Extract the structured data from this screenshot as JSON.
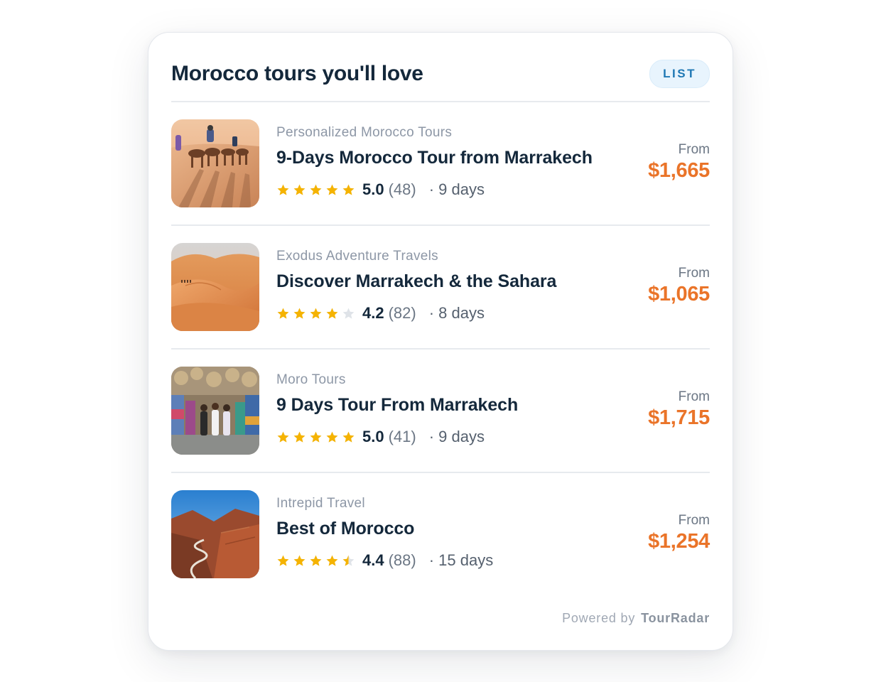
{
  "widget": {
    "title": "Morocco tours you'll love",
    "view_badge": "LIST",
    "footer": {
      "powered_by": "Powered by",
      "brand": "TourRadar"
    }
  },
  "colors": {
    "title": "#14283b",
    "price": "#ea7429",
    "star_filled": "#f5b301",
    "star_empty": "#dfe3e8",
    "badge_bg": "#e8f4fd",
    "badge_text": "#1f78b4"
  },
  "tours": [
    {
      "operator": "Personalized Morocco Tours",
      "name": "9-Days Morocco Tour from Marrakech",
      "rating": "5.0",
      "rating_value": 5.0,
      "reviews": "(48)",
      "duration": "· 9 days",
      "from_label": "From",
      "price": "$1,665",
      "image": "camel-caravan-desert-photo"
    },
    {
      "operator": "Exodus Adventure Travels",
      "name": "Discover Marrakech & the Sahara",
      "rating": "4.2",
      "rating_value": 4.0,
      "reviews": "(82)",
      "duration": "· 8 days",
      "from_label": "From",
      "price": "$1,065",
      "image": "sahara-sand-dunes-photo"
    },
    {
      "operator": "Moro Tours",
      "name": "9 Days Tour From Marrakech",
      "rating": "5.0",
      "rating_value": 5.0,
      "reviews": "(41)",
      "duration": "· 9 days",
      "from_label": "From",
      "price": "$1,715",
      "image": "marrakech-souk-market-photo"
    },
    {
      "operator": "Intrepid Travel",
      "name": "Best of Morocco",
      "rating": "4.4",
      "rating_value": 4.5,
      "reviews": "(88)",
      "duration": "· 15 days",
      "from_label": "From",
      "price": "$1,254",
      "image": "atlas-mountain-road-photo"
    }
  ]
}
